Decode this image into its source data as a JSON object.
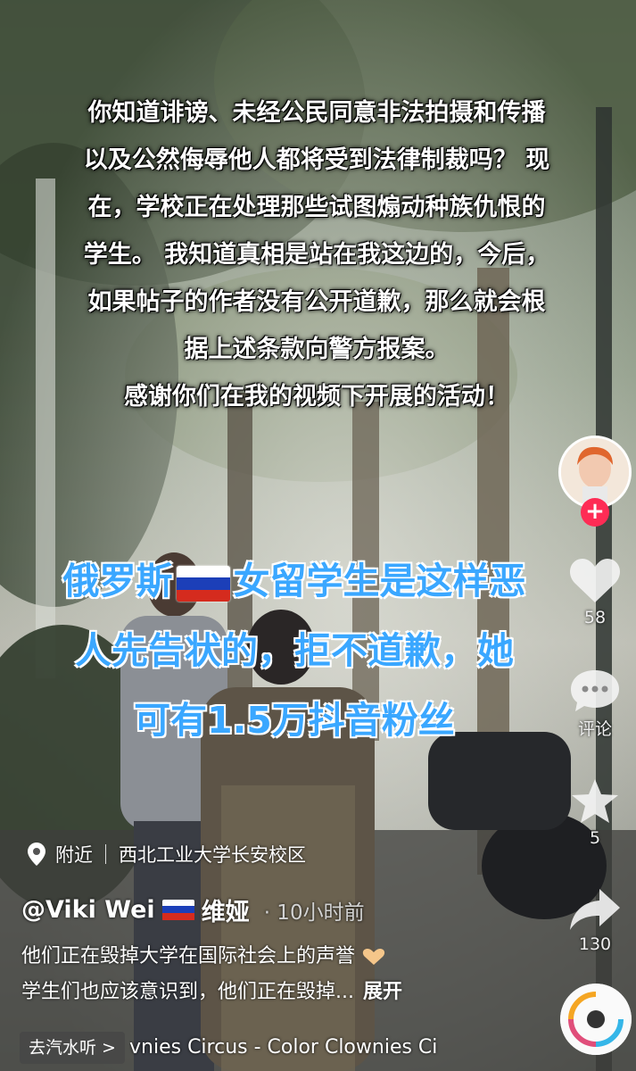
{
  "overlay_caption": [
    "你知道诽谤、未经公民同意非法拍摄和传播",
    "以及公然侮辱他人都将受到法律制裁吗？ 现",
    "在，学校正在处理那些试图煽动种族仇恨的",
    "学生。 我知道真相是站在我这边的，今后，",
    "如果帖子的作者没有公开道歉，那么就会根",
    "据上述条款向警方报案。",
    "感谢你们在我的视频下开展的活动！"
  ],
  "banner": {
    "line1_before_flag": "俄罗斯",
    "line1_after_flag": "女留学生是这样恶",
    "line2": "人先告状的，拒不道歉，她",
    "line3": "可有1.5万抖音粉丝"
  },
  "rail": {
    "follow_symbol": "+",
    "likes": "58",
    "comments_label": "评论",
    "favorites": "5",
    "shares": "130"
  },
  "location": {
    "label": "附近",
    "place": "西北工业大学长安校区"
  },
  "author": {
    "handle": "@Viki Wei",
    "name": "维娅",
    "time": "· 10小时前"
  },
  "description": {
    "line1": "他们正在毁掉大学在国际社会上的声誉",
    "line2": "学生们也应该意识到，他们正在毁掉...",
    "expand": "展开"
  },
  "bottom": {
    "chip": "去汽水听 >",
    "music": "vnies   Circus  - Color Clownies   Ci"
  },
  "colors": {
    "banner_blue": "#3aa7ff",
    "follow_red": "#fe2c55",
    "flag_white": "#ffffff",
    "flag_blue": "#1c3fb8",
    "flag_red": "#d52b1e"
  }
}
